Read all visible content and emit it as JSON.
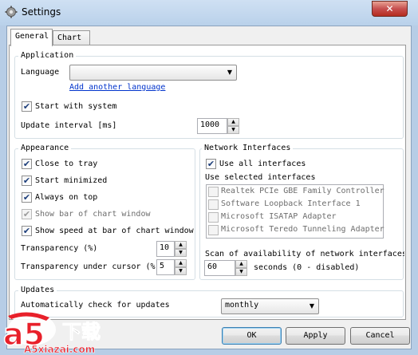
{
  "window": {
    "title": "Settings",
    "close_glyph": "✕"
  },
  "tabs": [
    "General",
    "Chart"
  ],
  "application": {
    "legend": "Application",
    "language_label": "Language",
    "language_value": "",
    "add_language_link": "Add another language",
    "start_with_system": {
      "label": "Start with system",
      "checked": true
    },
    "update_interval_label": "Update interval [ms]",
    "update_interval_value": "1000"
  },
  "appearance": {
    "legend": "Appearance",
    "close_to_tray": {
      "label": "Close to tray",
      "checked": true
    },
    "start_minimized": {
      "label": "Start minimized",
      "checked": true
    },
    "always_on_top": {
      "label": "Always on top",
      "checked": true
    },
    "show_bar": {
      "label": "Show bar of chart window",
      "checked": true,
      "disabled": true
    },
    "show_speed": {
      "label": "Show speed at bar of chart window",
      "checked": true
    },
    "transparency_label": "Transparency (%)",
    "transparency_value": "10",
    "transparency_cursor_label": "Transparency under cursor (%)",
    "transparency_cursor_value": "5"
  },
  "network": {
    "legend": "Network Interfaces",
    "use_all": {
      "label": "Use all interfaces",
      "checked": true
    },
    "use_selected_label": "Use selected interfaces",
    "interfaces": [
      "Realtek PCIe GBE Family Controller",
      "Software Loopback Interface 1",
      "Microsoft ISATAP Adapter",
      "Microsoft Teredo Tunneling Adapter"
    ],
    "scan_label": "Scan of availability of network interfaces:",
    "scan_value": "60",
    "scan_unit": "seconds (0 - disabled)"
  },
  "updates": {
    "legend": "Updates",
    "auto_check_label": "Automatically check for updates",
    "frequency_value": "monthly"
  },
  "buttons": {
    "ok": "OK",
    "apply": "Apply",
    "cancel": "Cancel"
  },
  "watermark": {
    "logo": "a5",
    "brand": "下载",
    "site": "A5xiazai.com"
  },
  "colors": {
    "title_bar": "#b9d1ea",
    "close_button": "#c75050",
    "link": "#0033cc",
    "watermark": "#e8202a"
  }
}
